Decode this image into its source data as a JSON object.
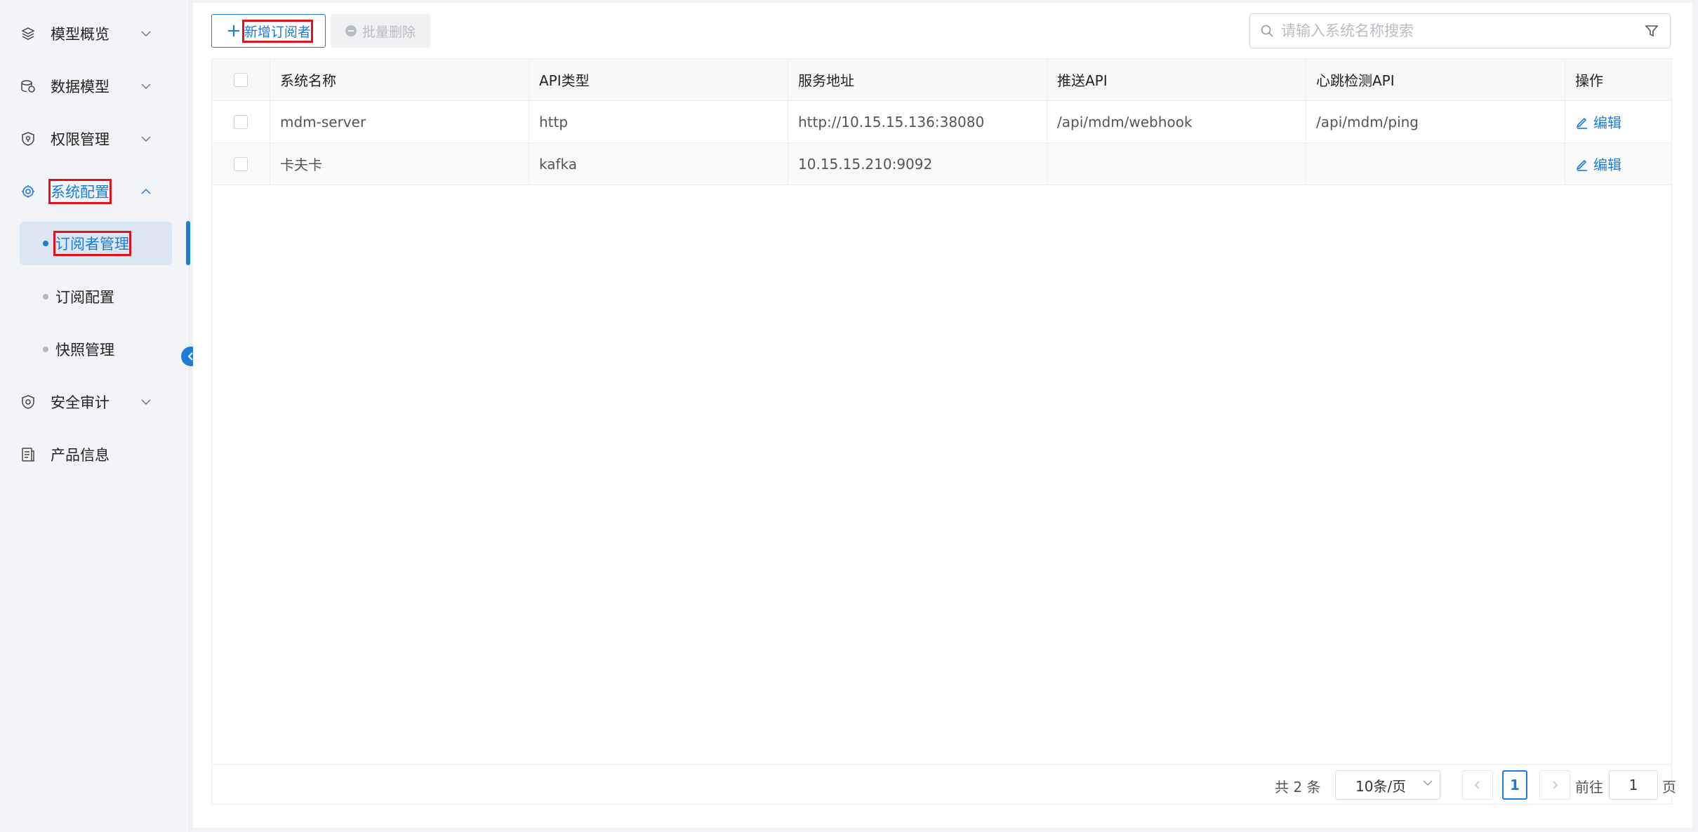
{
  "sidebar": {
    "items": [
      {
        "label": "模型概览",
        "icon": "layers-icon"
      },
      {
        "label": "数据模型",
        "icon": "database-icon"
      },
      {
        "label": "权限管理",
        "icon": "shield-icon"
      },
      {
        "label": "系统配置",
        "icon": "gear-icon"
      },
      {
        "label": "安全审计",
        "icon": "audit-shield-icon"
      },
      {
        "label": "产品信息",
        "icon": "document-icon"
      }
    ],
    "sub_items": [
      {
        "label": "订阅者管理"
      },
      {
        "label": "订阅配置"
      },
      {
        "label": "快照管理"
      }
    ]
  },
  "toolbar": {
    "add_label": "新增订阅者",
    "batch_delete_label": "批量删除"
  },
  "search": {
    "placeholder": "请输入系统名称搜索"
  },
  "table": {
    "headers": [
      "系统名称",
      "API类型",
      "服务地址",
      "推送API",
      "心跳检测API",
      "操作"
    ],
    "rows": [
      {
        "name": "mdm-server",
        "api_type": "http",
        "address": "http://10.15.15.136:38080",
        "push_api": "/api/mdm/webhook",
        "heartbeat_api": "/api/mdm/ping",
        "action": "编辑"
      },
      {
        "name": "卡夫卡",
        "api_type": "kafka",
        "address": "10.15.15.210:9092",
        "push_api": "",
        "heartbeat_api": "",
        "action": "编辑"
      }
    ]
  },
  "pagination": {
    "total_text": "共 2 条",
    "page_size": "10条/页",
    "current_page": "1",
    "goto_label": "前往",
    "goto_value": "1",
    "page_unit": "页"
  },
  "colors": {
    "accent": "#1c7cd6",
    "highlight": "#e0141c"
  }
}
